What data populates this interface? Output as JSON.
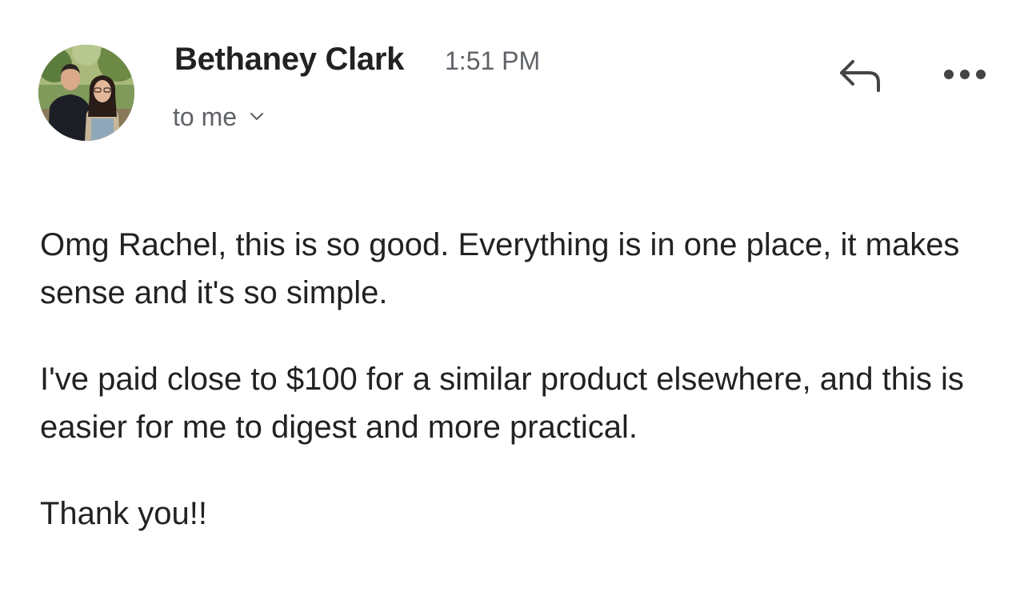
{
  "message": {
    "sender": {
      "name": "Bethaney Clark",
      "avatar": "profile-photo"
    },
    "time": "1:51 PM",
    "recipient": {
      "label": "to me",
      "icon": "chevron-down-icon"
    },
    "actions": {
      "reply_icon": "reply-icon",
      "more_icon": "more-options-icon"
    },
    "body": {
      "paragraphs": [
        "Omg Rachel, this is so good. Everything is in one place, it makes sense and it's so simple.",
        "I've paid close to $100 for a similar product elsewhere, and this is easier for me to digest and more practical.",
        "Thank you!!"
      ]
    }
  },
  "colors": {
    "text": "#222222",
    "secondary_text": "#5f6368",
    "icon": "#444444",
    "background": "#ffffff"
  }
}
